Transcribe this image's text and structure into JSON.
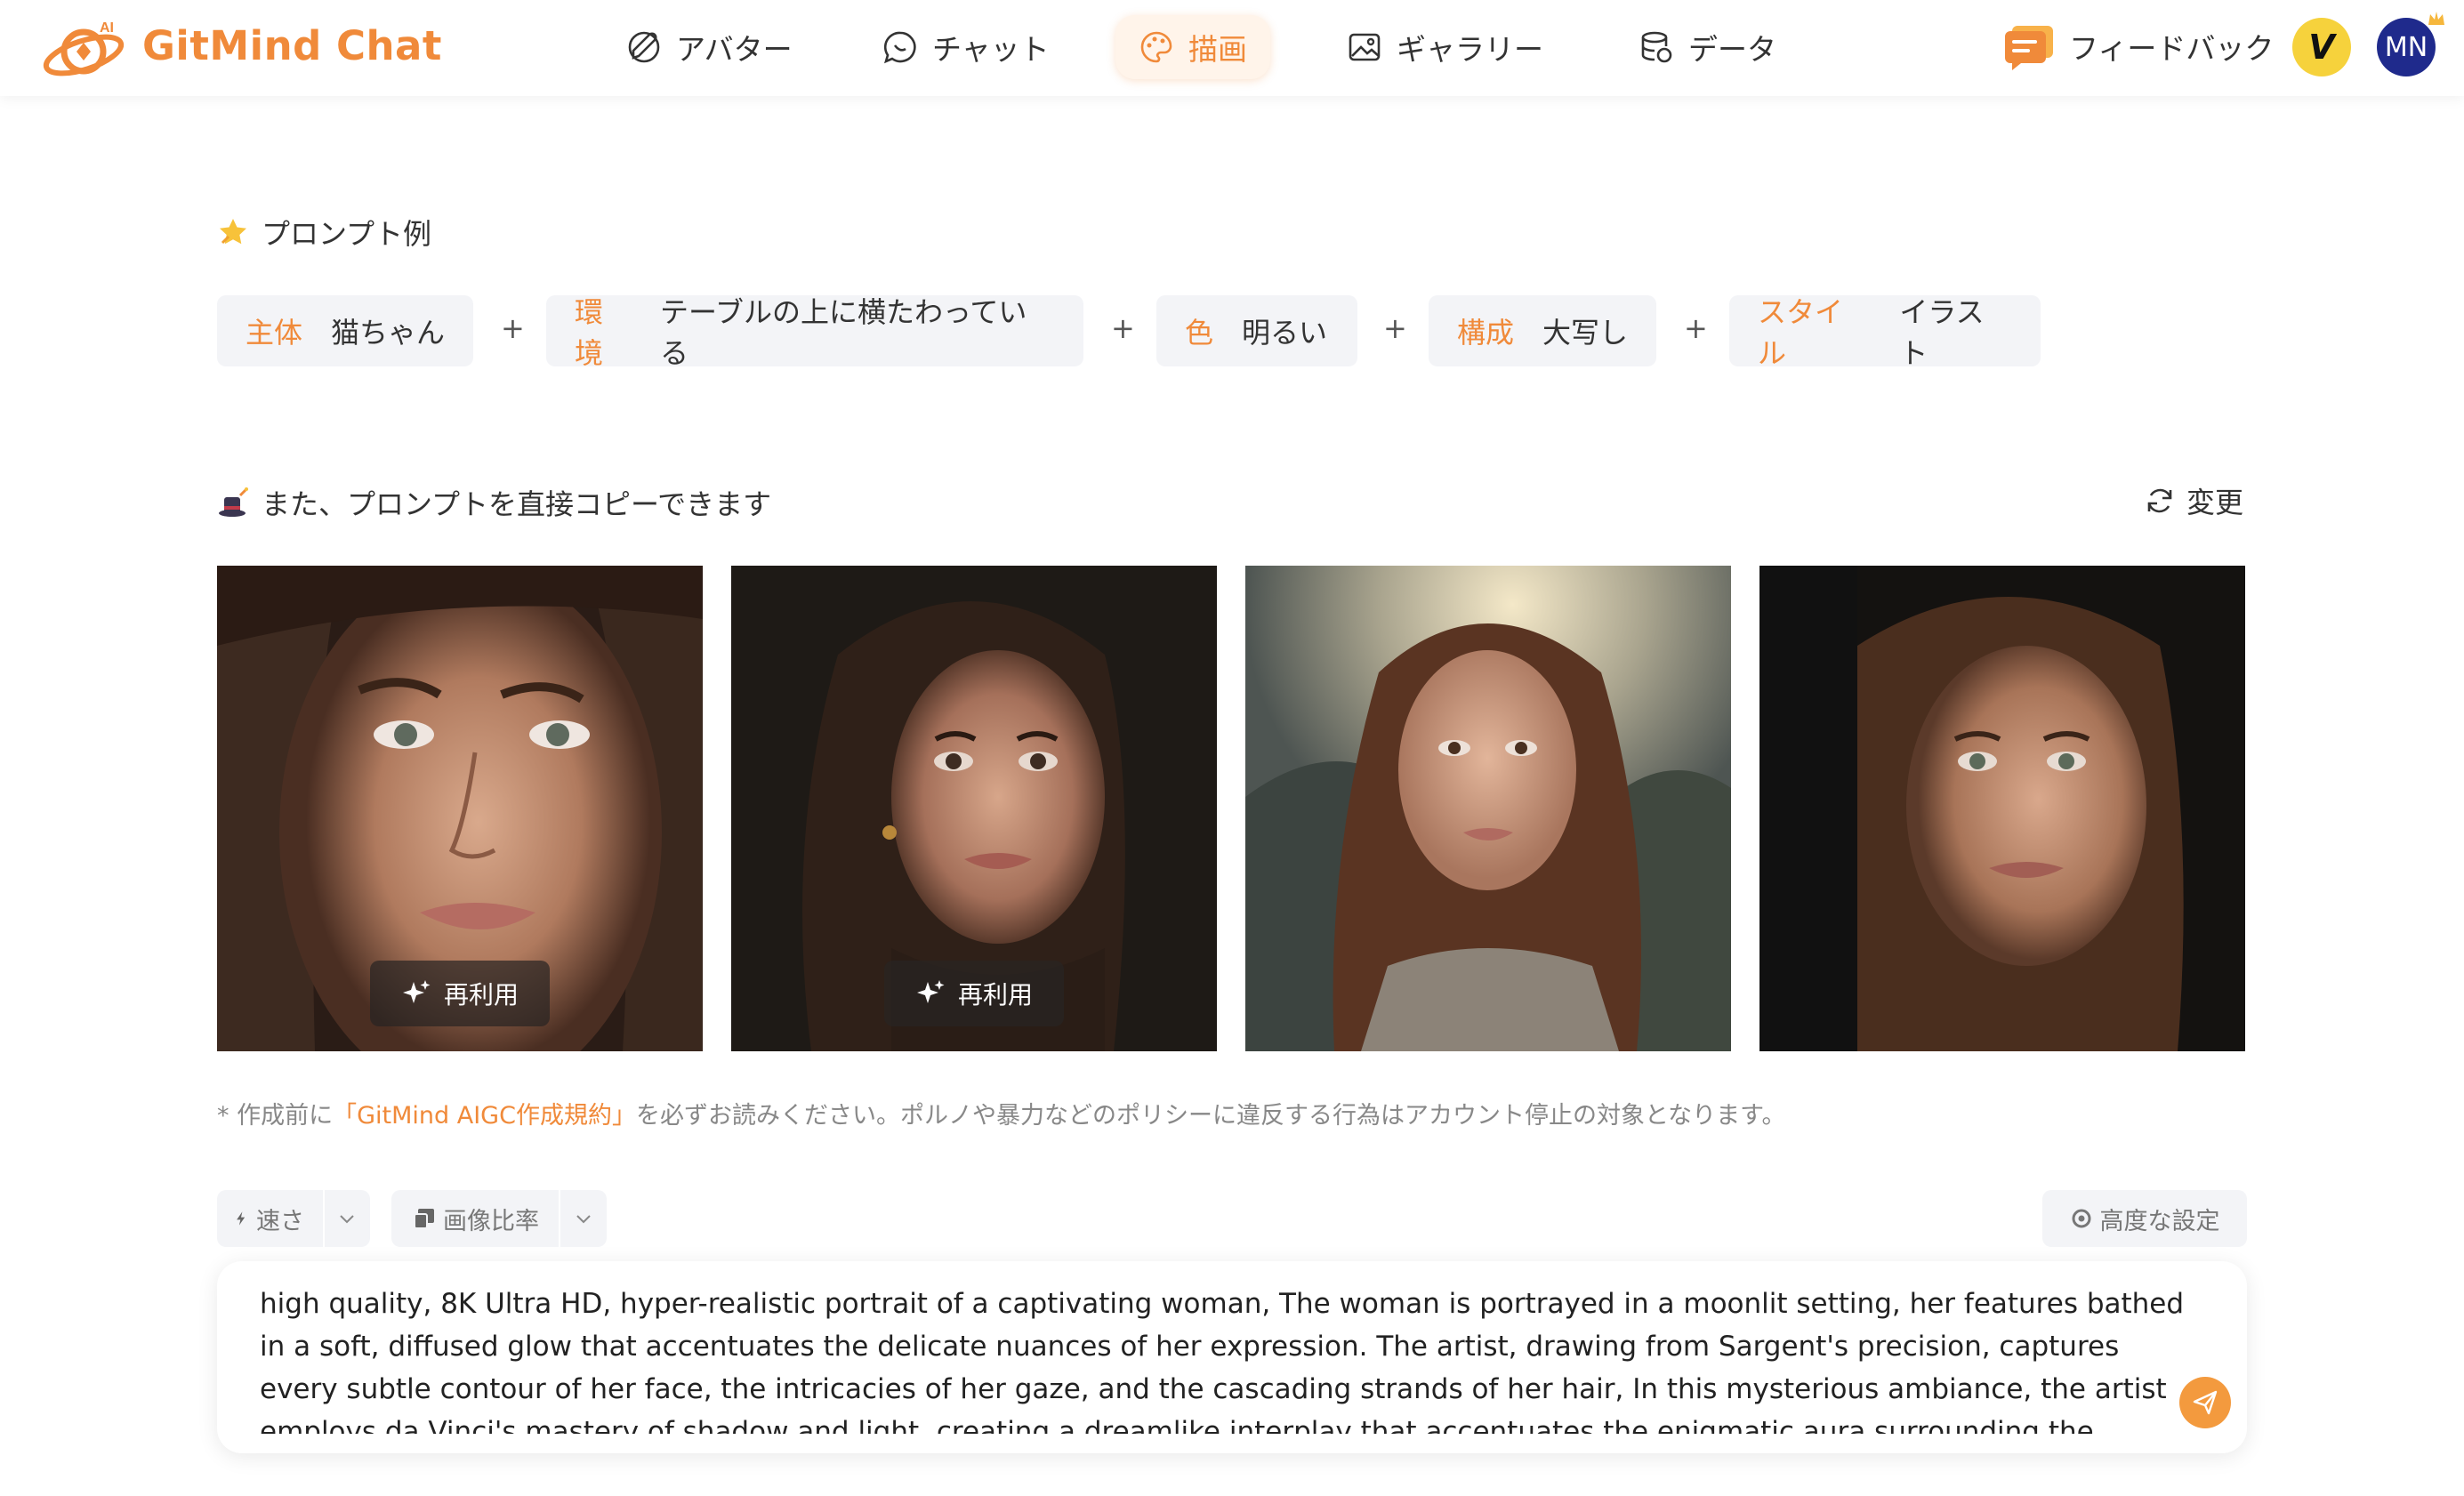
{
  "header": {
    "brand": "GitMind Chat",
    "logo_badge": "AI",
    "nav": [
      {
        "label": "アバター",
        "icon": "avatar-icon"
      },
      {
        "label": "チャット",
        "icon": "chat-icon"
      },
      {
        "label": "描画",
        "icon": "palette-icon",
        "active": true
      },
      {
        "label": "ギャラリー",
        "icon": "gallery-icon"
      },
      {
        "label": "データ",
        "icon": "database-icon"
      }
    ],
    "feedback_label": "フィードバック",
    "avatar_v": "V",
    "avatar_mn": "MN"
  },
  "prompt_examples": {
    "title": "プロンプト例",
    "chips": [
      {
        "key": "主体",
        "value": "猫ちゃん"
      },
      {
        "key": "環境",
        "value": "テーブルの上に横たわっている"
      },
      {
        "key": "色",
        "value": "明るい"
      },
      {
        "key": "構成",
        "value": "大写し"
      },
      {
        "key": "スタイル",
        "value": "イラスト"
      }
    ],
    "plus": "+"
  },
  "copy_section": {
    "title": "また、プロンプトを直接コピーできます",
    "refresh_label": "変更",
    "reuse_label": "再利用"
  },
  "notice": {
    "prefix": "* 作成前に",
    "link": "「GitMind AIGC作成規約」",
    "suffix": "を必ずお読みください。ポルノや暴力などのポリシーに違反する行為はアカウント停止の対象となります。"
  },
  "controls": {
    "speed": "速さ",
    "ratio": "画像比率",
    "advanced": "高度な設定"
  },
  "prompt_input": {
    "value": "high quality, 8K Ultra HD, hyper-realistic portrait of a captivating woman, The woman is portrayed in a moonlit setting, her features bathed in a soft, diffused glow that accentuates the delicate nuances of her expression. The artist, drawing from Sargent's precision, captures every subtle contour of her face, the intricacies of her gaze, and the cascading strands of her hair, In this mysterious ambiance, the artist employs da Vinci's mastery of shadow and light, creating a dreamlike interplay that accentuates the enigmatic aura surrounding the woman. She is adorned"
  },
  "colors": {
    "accent": "#F08A3A",
    "chip_bg": "#F3F4F7",
    "avatar_v": "#F6D23C",
    "avatar_mn": "#1F2A8C"
  }
}
